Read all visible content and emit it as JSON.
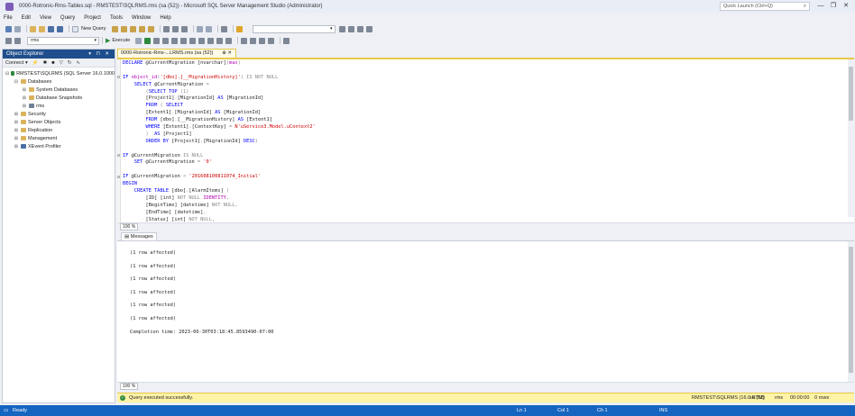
{
  "window": {
    "title": "0000-Rotronic-Rms-Tables.sql - RMSTEST\\SQLRMS.rms (sa (52)) - Microsoft SQL Server Management Studio (Administrator)",
    "quick_launch_placeholder": "Quick Launch (Ctrl+Q)",
    "minimize": "—",
    "restore": "❐",
    "close": "✕"
  },
  "menu": [
    "File",
    "Edit",
    "View",
    "Query",
    "Project",
    "Tools",
    "Window",
    "Help"
  ],
  "toolbar1": {
    "new_query": "New Query"
  },
  "toolbar2": {
    "database": "rms",
    "execute": "Execute"
  },
  "object_explorer": {
    "title": "Object Explorer",
    "header_buttons": "▾ ⊓ ✕",
    "connect": "Connect ▾",
    "tree": [
      {
        "label": "RMSTEST\\SQLRMS (SQL Server 16.0.1000",
        "indent": 0,
        "icon": "server",
        "expander": "⊟"
      },
      {
        "label": "Databases",
        "indent": 1,
        "icon": "folder",
        "expander": "⊟"
      },
      {
        "label": "System Databases",
        "indent": 2,
        "icon": "folder",
        "expander": "⊞"
      },
      {
        "label": "Database Snapshots",
        "indent": 2,
        "icon": "folder",
        "expander": "⊞"
      },
      {
        "label": "rms",
        "indent": 2,
        "icon": "dbico",
        "expander": "⊞"
      },
      {
        "label": "Security",
        "indent": 1,
        "icon": "folder",
        "expander": "⊞"
      },
      {
        "label": "Server Objects",
        "indent": 1,
        "icon": "folder",
        "expander": "⊞"
      },
      {
        "label": "Replication",
        "indent": 1,
        "icon": "folder",
        "expander": "⊞"
      },
      {
        "label": "Management",
        "indent": 1,
        "icon": "folder",
        "expander": "⊞"
      },
      {
        "label": "XEvent Profiler",
        "indent": 1,
        "icon": "xevent",
        "expander": "⊞"
      }
    ]
  },
  "editor": {
    "tab_label": "0000-Rotronic-Rms-...LRMS.rms (sa (52))",
    "tab_pin": "⊕ ✕",
    "zoom": "100 %"
  },
  "code_lines": [
    [
      [
        "DECLARE ",
        "kw"
      ],
      [
        "@CurrentMigration ",
        "plain"
      ],
      [
        "[nvarchar]",
        "plain"
      ],
      [
        "(",
        "gray"
      ],
      [
        "max",
        "fn"
      ],
      [
        ")",
        "gray"
      ]
    ],
    [
      [
        "",
        "plain"
      ]
    ],
    [
      [
        "IF ",
        "kw"
      ],
      [
        "object_id",
        "fn"
      ],
      [
        "(",
        "gray"
      ],
      [
        "'[dbo].[__MigrationHistory]'",
        "str"
      ],
      [
        ")",
        "gray"
      ],
      [
        " IS NOT NULL",
        "gray"
      ]
    ],
    [
      [
        "    SELECT ",
        "kw"
      ],
      [
        "@CurrentMigration ",
        "plain"
      ],
      [
        "=",
        "gray"
      ]
    ],
    [
      [
        "        (",
        "gray"
      ],
      [
        "SELECT TOP ",
        "kw"
      ],
      [
        "(1)",
        "gray"
      ]
    ],
    [
      [
        "        [Project1]",
        "plain"
      ],
      [
        ".",
        "gray"
      ],
      [
        "[MigrationId] ",
        "plain"
      ],
      [
        "AS ",
        "kw"
      ],
      [
        "[MigrationId]",
        "plain"
      ]
    ],
    [
      [
        "        FROM ",
        "kw"
      ],
      [
        "( ",
        "gray"
      ],
      [
        "SELECT",
        "kw"
      ]
    ],
    [
      [
        "        [Extent1]",
        "plain"
      ],
      [
        ".",
        "gray"
      ],
      [
        "[MigrationId] ",
        "plain"
      ],
      [
        "AS ",
        "kw"
      ],
      [
        "[MigrationId]",
        "plain"
      ]
    ],
    [
      [
        "        FROM ",
        "kw"
      ],
      [
        "[dbo]",
        "plain"
      ],
      [
        ".",
        "gray"
      ],
      [
        "[__MigrationHistory] ",
        "plain"
      ],
      [
        "AS ",
        "kw"
      ],
      [
        "[Extent1]",
        "plain"
      ]
    ],
    [
      [
        "        WHERE ",
        "kw"
      ],
      [
        "[Extent1]",
        "plain"
      ],
      [
        ".",
        "gray"
      ],
      [
        "[ContextKey] ",
        "plain"
      ],
      [
        "= ",
        "gray"
      ],
      [
        "N'uService3.Model.uContext2'",
        "str"
      ]
    ],
    [
      [
        "        )  ",
        "gray"
      ],
      [
        "AS ",
        "kw"
      ],
      [
        "[Project1]",
        "plain"
      ]
    ],
    [
      [
        "        ORDER BY ",
        "kw"
      ],
      [
        "[Project1]",
        "plain"
      ],
      [
        ".",
        "gray"
      ],
      [
        "[MigrationId] ",
        "plain"
      ],
      [
        "DESC",
        "kw"
      ],
      [
        ")",
        "gray"
      ]
    ],
    [
      [
        "",
        "plain"
      ]
    ],
    [
      [
        "IF ",
        "kw"
      ],
      [
        "@CurrentMigration ",
        "plain"
      ],
      [
        "IS NULL",
        "gray"
      ]
    ],
    [
      [
        "    SET ",
        "kw"
      ],
      [
        "@CurrentMigration ",
        "plain"
      ],
      [
        "= ",
        "gray"
      ],
      [
        "'0'",
        "str"
      ]
    ],
    [
      [
        "",
        "plain"
      ]
    ],
    [
      [
        "IF ",
        "kw"
      ],
      [
        "@CurrentMigration ",
        "plain"
      ],
      [
        "< ",
        "gray"
      ],
      [
        "'201608100811074_Initial'",
        "str"
      ]
    ],
    [
      [
        "BEGIN",
        "kw"
      ]
    ],
    [
      [
        "    CREATE TABLE ",
        "kw"
      ],
      [
        "[dbo]",
        "plain"
      ],
      [
        ".",
        "gray"
      ],
      [
        "[AlarmItems] ",
        "plain"
      ],
      [
        "(",
        "gray"
      ]
    ],
    [
      [
        "        [ID] ",
        "plain"
      ],
      [
        "[int] ",
        "plain"
      ],
      [
        "NOT NULL ",
        "gray"
      ],
      [
        "IDENTITY",
        "fn"
      ],
      [
        ",",
        "gray"
      ]
    ],
    [
      [
        "        [BeginTime] ",
        "plain"
      ],
      [
        "[datetime] ",
        "plain"
      ],
      [
        "NOT NULL",
        "gray"
      ],
      [
        ",",
        "gray"
      ]
    ],
    [
      [
        "        [EndTime] ",
        "plain"
      ],
      [
        "[datetime]",
        "plain"
      ],
      [
        ",",
        "gray"
      ]
    ],
    [
      [
        "        [Status] ",
        "plain"
      ],
      [
        "[int] ",
        "plain"
      ],
      [
        "NOT NULL",
        "gray"
      ],
      [
        ",",
        "gray"
      ]
    ]
  ],
  "messages": {
    "tab_label": "Messages",
    "lines": [
      "(1 row affected)",
      "(1 row affected)",
      "(1 row affected)",
      "(1 row affected)",
      "(1 row affected)",
      "(1 row affected)",
      "Completion time: 2023-06-30T03:18:45.8593490-07:00"
    ],
    "zoom": "100 %"
  },
  "query_status": {
    "message": "Query executed successfully.",
    "server": "RMSTEST\\SQLRMS (16.0 RTM)",
    "user": "sa (52)",
    "database": "rms",
    "elapsed": "00:00:00",
    "rows": "0 rows"
  },
  "statusbar": {
    "state": "Ready",
    "line": "Ln 1",
    "col": "Col 1",
    "ch": "Ch 1",
    "mode": "INS"
  }
}
